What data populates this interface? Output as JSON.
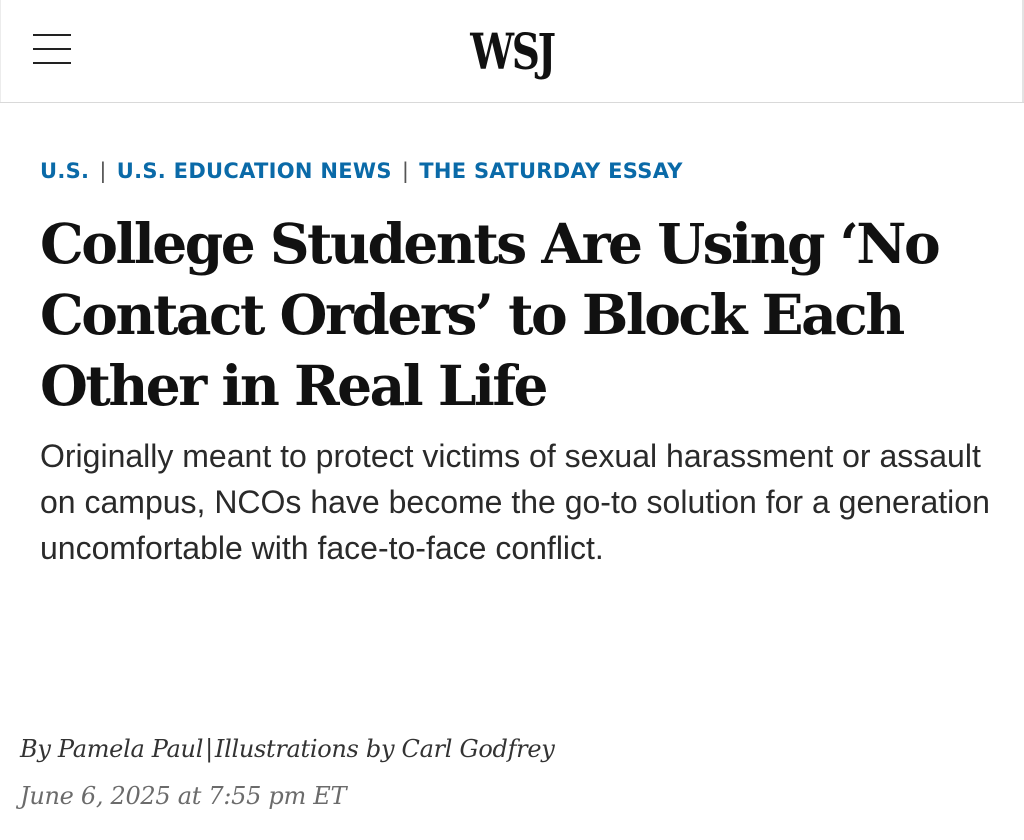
{
  "header": {
    "logo": "WSJ",
    "menu_icon": "hamburger-menu-icon"
  },
  "breadcrumb": {
    "items": [
      {
        "label": "U.S."
      },
      {
        "label": "U.S. EDUCATION NEWS"
      },
      {
        "label": "THE SATURDAY ESSAY"
      }
    ],
    "separator": "|"
  },
  "article": {
    "headline": "College Students Are Using ‘No Contact Orders’ to Block Each Other in Real Life",
    "dek": "Originally meant to protect victims of sexual harassment or assault on campus, NCOs have become the go-to solution for a generation uncomfortable with face-to-face conflict.",
    "byline": {
      "author": "By Pamela Paul",
      "separator": "|",
      "illustrations": "Illustrations by Carl Godfrey"
    },
    "date": "June 6, 2025 at 7:55 pm ET"
  },
  "colors": {
    "breadcrumb": "#0a6aa8",
    "headline": "#111111",
    "dek": "#2a2a2a",
    "date": "#6b6b6b"
  }
}
